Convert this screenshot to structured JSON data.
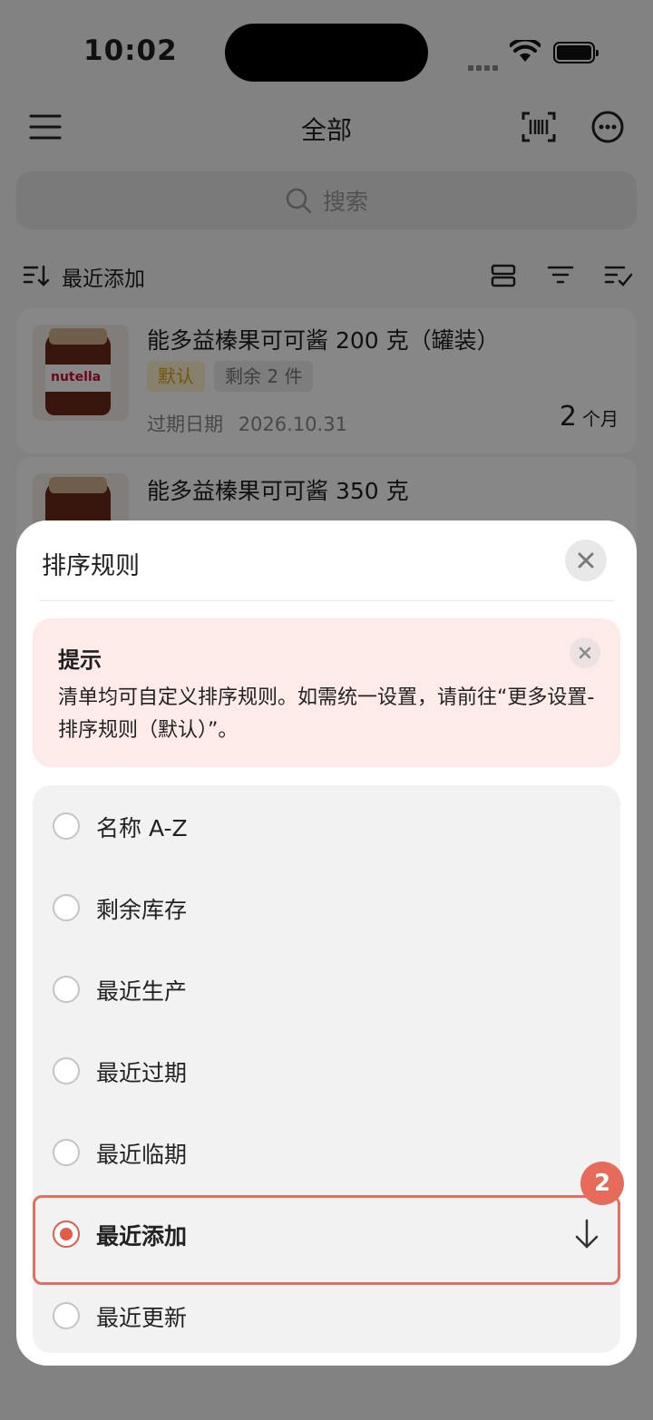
{
  "status_bar": {
    "time": "10:02"
  },
  "nav": {
    "title": "全部",
    "menu_icon": "menu-icon",
    "scan_icon": "barcode-scan-icon",
    "more_icon": "more-icon"
  },
  "search": {
    "placeholder": "搜索"
  },
  "sort_bar": {
    "label": "最近添加"
  },
  "products": [
    {
      "name": "能多益榛果可可酱 200 克（罐装）",
      "tag_default": "默认",
      "tag_remaining": "剩余 2 件",
      "expiry_label": "过期日期",
      "expiry_date": "2026.10.31",
      "remaining_value": "2",
      "remaining_unit": "个月"
    },
    {
      "name": "能多益榛果可可酱 350 克"
    }
  ],
  "sheet": {
    "title": "排序规则",
    "tip": {
      "title": "提示",
      "text": "清单均可自定义排序规则。如需统一设置，请前往“更多设置-排序规则（默认）”。"
    },
    "options": [
      {
        "label": "名称 A-Z",
        "selected": false
      },
      {
        "label": "剩余库存",
        "selected": false
      },
      {
        "label": "最近生产",
        "selected": false
      },
      {
        "label": "最近过期",
        "selected": false
      },
      {
        "label": "最近临期",
        "selected": false
      },
      {
        "label": "最近添加",
        "selected": true
      },
      {
        "label": "最近更新",
        "selected": false
      }
    ]
  },
  "annotation": {
    "badge": "2"
  },
  "colors": {
    "accent": "#e35b4a",
    "tip_bg": "#fdebea",
    "tag_default_text": "#d6a514"
  }
}
